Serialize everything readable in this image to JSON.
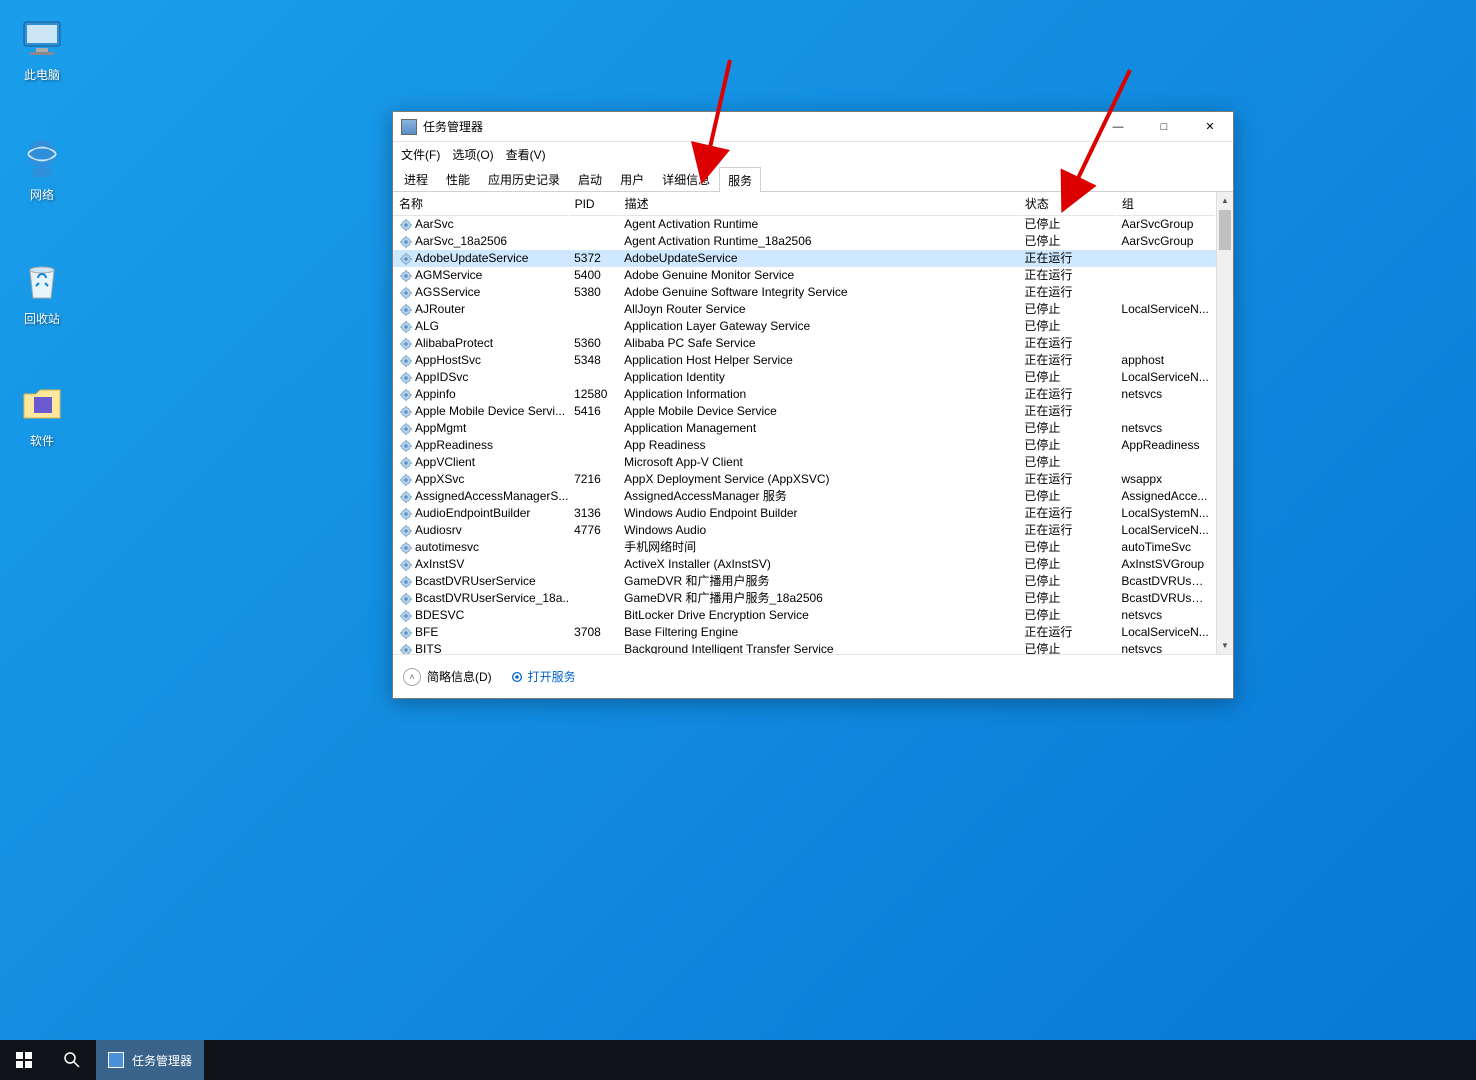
{
  "desktop": {
    "icons": [
      {
        "label": "此电脑"
      },
      {
        "label": "网络"
      },
      {
        "label": "回收站"
      },
      {
        "label": "软件"
      }
    ]
  },
  "taskbar": {
    "app_label": "任务管理器"
  },
  "window": {
    "title": "任务管理器",
    "menu": {
      "file": "文件(F)",
      "options": "选项(O)",
      "view": "查看(V)"
    },
    "tabs": [
      "进程",
      "性能",
      "应用历史记录",
      "启动",
      "用户",
      "详细信息",
      "服务"
    ],
    "active_tab": 6,
    "columns": {
      "name": "名称",
      "pid": "PID",
      "desc": "描述",
      "status": "状态",
      "group": "组"
    },
    "footer": {
      "less": "简略信息(D)",
      "open": "打开服务"
    },
    "services": [
      {
        "name": "AarSvc",
        "pid": "",
        "desc": "Agent Activation Runtime",
        "status": "已停止",
        "group": "AarSvcGroup"
      },
      {
        "name": "AarSvc_18a2506",
        "pid": "",
        "desc": "Agent Activation Runtime_18a2506",
        "status": "已停止",
        "group": "AarSvcGroup"
      },
      {
        "name": "AdobeUpdateService",
        "pid": "5372",
        "desc": "AdobeUpdateService",
        "status": "正在运行",
        "group": "",
        "selected": true
      },
      {
        "name": "AGMService",
        "pid": "5400",
        "desc": "Adobe Genuine Monitor Service",
        "status": "正在运行",
        "group": ""
      },
      {
        "name": "AGSService",
        "pid": "5380",
        "desc": "Adobe Genuine Software Integrity Service",
        "status": "正在运行",
        "group": ""
      },
      {
        "name": "AJRouter",
        "pid": "",
        "desc": "AllJoyn Router Service",
        "status": "已停止",
        "group": "LocalServiceN..."
      },
      {
        "name": "ALG",
        "pid": "",
        "desc": "Application Layer Gateway Service",
        "status": "已停止",
        "group": ""
      },
      {
        "name": "AlibabaProtect",
        "pid": "5360",
        "desc": "Alibaba PC Safe Service",
        "status": "正在运行",
        "group": ""
      },
      {
        "name": "AppHostSvc",
        "pid": "5348",
        "desc": "Application Host Helper Service",
        "status": "正在运行",
        "group": "apphost"
      },
      {
        "name": "AppIDSvc",
        "pid": "",
        "desc": "Application Identity",
        "status": "已停止",
        "group": "LocalServiceN..."
      },
      {
        "name": "Appinfo",
        "pid": "12580",
        "desc": "Application Information",
        "status": "正在运行",
        "group": "netsvcs"
      },
      {
        "name": "Apple Mobile Device Servi...",
        "pid": "5416",
        "desc": "Apple Mobile Device Service",
        "status": "正在运行",
        "group": ""
      },
      {
        "name": "AppMgmt",
        "pid": "",
        "desc": "Application Management",
        "status": "已停止",
        "group": "netsvcs"
      },
      {
        "name": "AppReadiness",
        "pid": "",
        "desc": "App Readiness",
        "status": "已停止",
        "group": "AppReadiness"
      },
      {
        "name": "AppVClient",
        "pid": "",
        "desc": "Microsoft App-V Client",
        "status": "已停止",
        "group": ""
      },
      {
        "name": "AppXSvc",
        "pid": "7216",
        "desc": "AppX Deployment Service (AppXSVC)",
        "status": "正在运行",
        "group": "wsappx"
      },
      {
        "name": "AssignedAccessManagerS...",
        "pid": "",
        "desc": "AssignedAccessManager 服务",
        "status": "已停止",
        "group": "AssignedAcce..."
      },
      {
        "name": "AudioEndpointBuilder",
        "pid": "3136",
        "desc": "Windows Audio Endpoint Builder",
        "status": "正在运行",
        "group": "LocalSystemN..."
      },
      {
        "name": "Audiosrv",
        "pid": "4776",
        "desc": "Windows Audio",
        "status": "正在运行",
        "group": "LocalServiceN..."
      },
      {
        "name": "autotimesvc",
        "pid": "",
        "desc": "手机网络时间",
        "status": "已停止",
        "group": "autoTimeSvc"
      },
      {
        "name": "AxInstSV",
        "pid": "",
        "desc": "ActiveX Installer (AxInstSV)",
        "status": "已停止",
        "group": "AxInstSVGroup"
      },
      {
        "name": "BcastDVRUserService",
        "pid": "",
        "desc": "GameDVR 和广播用户服务",
        "status": "已停止",
        "group": "BcastDVRUser..."
      },
      {
        "name": "BcastDVRUserService_18a...",
        "pid": "",
        "desc": "GameDVR 和广播用户服务_18a2506",
        "status": "已停止",
        "group": "BcastDVRUser..."
      },
      {
        "name": "BDESVC",
        "pid": "",
        "desc": "BitLocker Drive Encryption Service",
        "status": "已停止",
        "group": "netsvcs"
      },
      {
        "name": "BFE",
        "pid": "3708",
        "desc": "Base Filtering Engine",
        "status": "正在运行",
        "group": "LocalServiceN..."
      },
      {
        "name": "BITS",
        "pid": "",
        "desc": "Background Intelligent Transfer Service",
        "status": "已停止",
        "group": "netsvcs"
      }
    ]
  }
}
